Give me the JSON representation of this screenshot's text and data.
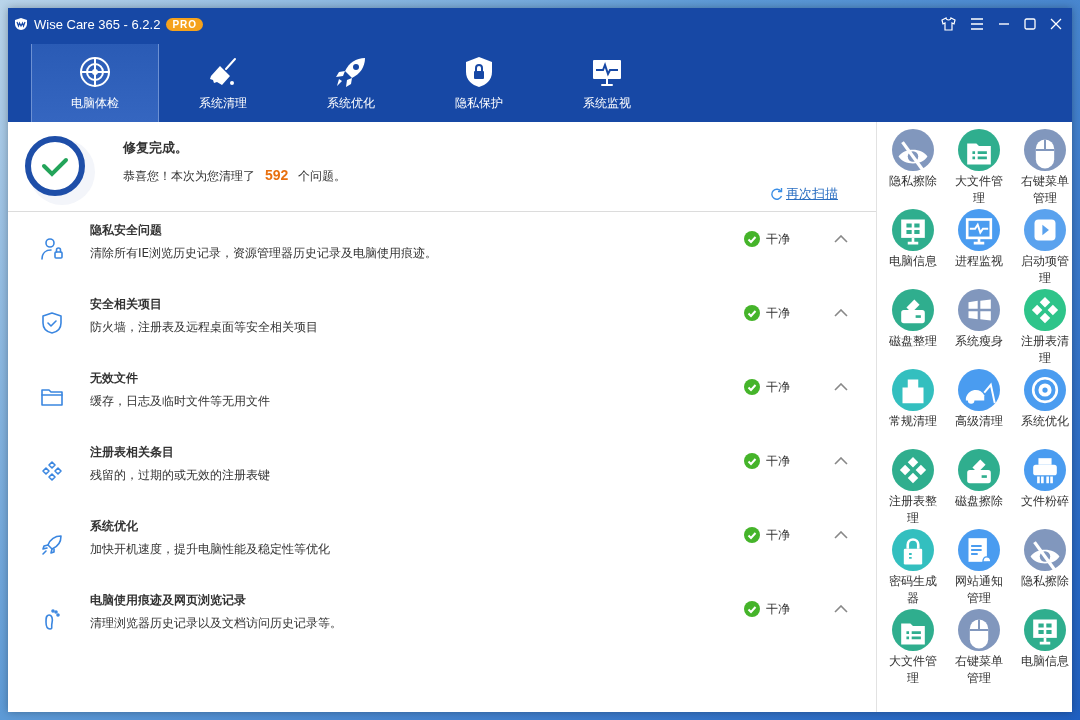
{
  "window": {
    "title": "Wise Care 365 - 6.2.2",
    "badge": "PRO"
  },
  "tabs": [
    {
      "label": "电脑体检",
      "kind": "radar",
      "selected": true
    },
    {
      "label": "系统清理",
      "kind": "broom",
      "selected": false
    },
    {
      "label": "系统优化",
      "kind": "rocket",
      "selected": false
    },
    {
      "label": "隐私保护",
      "kind": "shield-lock",
      "selected": false
    },
    {
      "label": "系统监视",
      "kind": "monitor-pulse",
      "selected": false
    }
  ],
  "summary": {
    "title": "修复完成。",
    "message_before": "恭喜您！本次为您清理了",
    "count": "592",
    "message_after": "个问题。",
    "rescan_link": "再次扫描"
  },
  "check_items": [
    {
      "kind": "user-lock",
      "title": "隐私安全问题",
      "description": "清除所有IE浏览历史记录，资源管理器历史记录及电脑使用痕迹。",
      "status": "干净"
    },
    {
      "kind": "shield",
      "title": "安全相关项目",
      "description": "防火墙，注册表及远程桌面等安全相关项目",
      "status": "干净"
    },
    {
      "kind": "folder",
      "title": "无效文件",
      "description": "缓存，日志及临时文件等无用文件",
      "status": "干净"
    },
    {
      "kind": "dots",
      "title": "注册表相关条目",
      "description": "残留的，过期的或无效的注册表键",
      "status": "干净"
    },
    {
      "kind": "rocket",
      "title": "系统优化",
      "description": "加快开机速度，提升电脑性能及稳定性等优化",
      "status": "干净"
    },
    {
      "kind": "foot",
      "title": "电脑使用痕迹及网页浏览记录",
      "description": "清理浏览器历史记录以及文档访问历史记录等。",
      "status": "干净"
    }
  ],
  "tools": [
    {
      "label": "隐私擦除",
      "kind": "eye-slash",
      "color": "#8197bd"
    },
    {
      "label": "大文件管理",
      "kind": "folder-list",
      "color": "#2fae8e"
    },
    {
      "label": "右键菜单管理",
      "kind": "mouse",
      "color": "#8197bd"
    },
    {
      "label": "电脑信息",
      "kind": "monitor",
      "color": "#2fae8e"
    },
    {
      "label": "进程监视",
      "kind": "monitor-pulse",
      "color": "#4a9cf0"
    },
    {
      "label": "启动项管理",
      "kind": "play",
      "color": "#5aa2ee"
    },
    {
      "label": "磁盘整理",
      "kind": "disk",
      "color": "#2fae8e"
    },
    {
      "label": "系统瘦身",
      "kind": "windows",
      "color": "#8197bd"
    },
    {
      "label": "注册表清理",
      "kind": "diamonds",
      "color": "#2ec48a"
    },
    {
      "label": "常规清理",
      "kind": "broom",
      "color": "#33bfbf"
    },
    {
      "label": "高级清理",
      "kind": "vacuum",
      "color": "#4a9cf0"
    },
    {
      "label": "系统优化",
      "kind": "gear",
      "color": "#4a9cf0"
    },
    {
      "label": "注册表整理",
      "kind": "diamonds",
      "color": "#2fae8e"
    },
    {
      "label": "磁盘擦除",
      "kind": "disk",
      "color": "#2fae8e"
    },
    {
      "label": "文件粉碎",
      "kind": "printer",
      "color": "#4a9cf0"
    },
    {
      "label": "密码生成器",
      "kind": "lock",
      "color": "#33bfbf"
    },
    {
      "label": "网站通知管理",
      "kind": "web-bell",
      "color": "#4a9cf0"
    },
    {
      "label": "隐私擦除",
      "kind": "eye-slash",
      "color": "#8197bd"
    },
    {
      "label": "大文件管理",
      "kind": "folder-list",
      "color": "#2fae8e"
    },
    {
      "label": "右键菜单管理",
      "kind": "mouse",
      "color": "#8197bd"
    },
    {
      "label": "电脑信息",
      "kind": "monitor",
      "color": "#2fae8e"
    }
  ]
}
